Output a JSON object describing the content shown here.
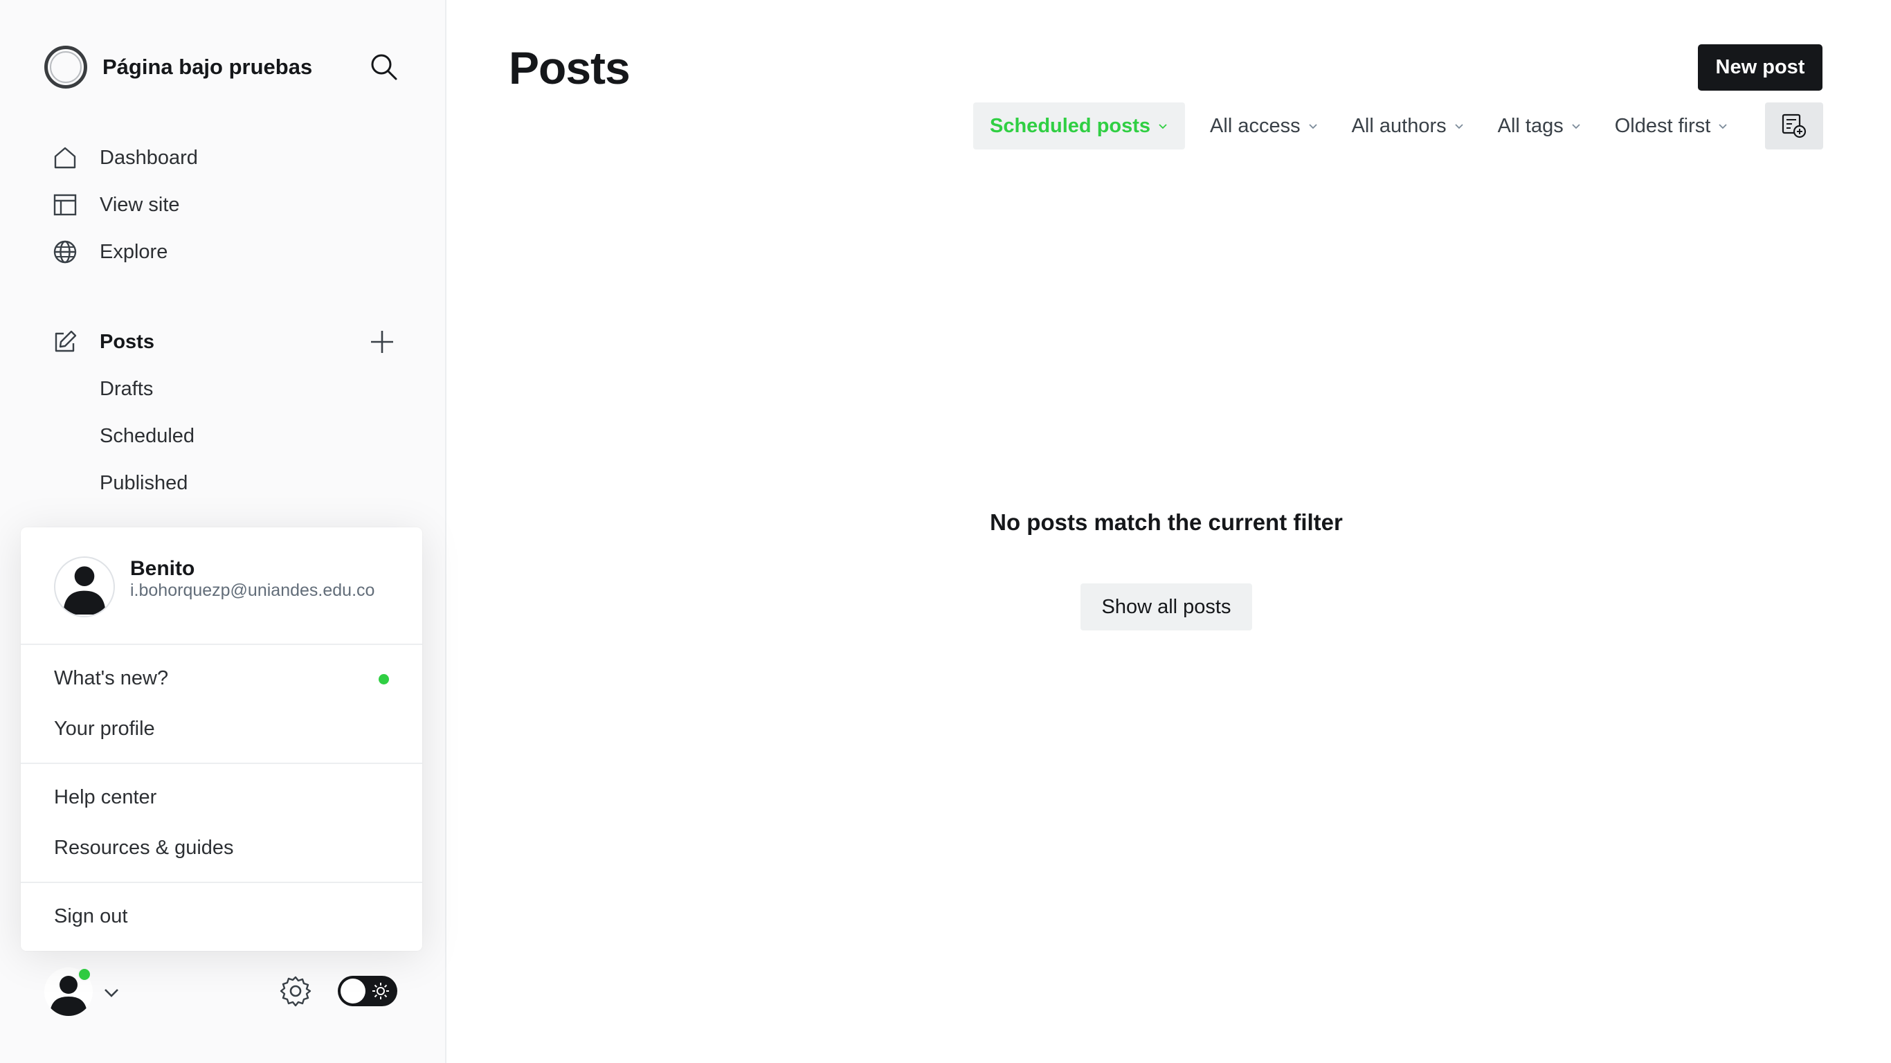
{
  "brand": {
    "name": "Página bajo pruebas"
  },
  "nav": {
    "dashboard": "Dashboard",
    "view_site": "View site",
    "explore": "Explore",
    "posts": "Posts",
    "drafts": "Drafts",
    "scheduled": "Scheduled",
    "published": "Published"
  },
  "user_menu": {
    "name": "Benito",
    "email": "i.bohorquezp@uniandes.edu.co",
    "whats_new": "What's new?",
    "profile": "Your profile",
    "help": "Help center",
    "resources": "Resources & guides",
    "sign_out": "Sign out"
  },
  "main": {
    "title": "Posts",
    "new_post": "New post",
    "filters": {
      "type": "Scheduled posts",
      "access": "All access",
      "authors": "All authors",
      "tags": "All tags",
      "order": "Oldest first"
    },
    "empty_message": "No posts match the current filter",
    "show_all": "Show all posts"
  },
  "colors": {
    "accent_green": "#30cf43",
    "dark": "#15171a",
    "sidebar_bg": "#fafafb"
  },
  "icons": [
    "search-icon",
    "home-icon",
    "layout-icon",
    "globe-icon",
    "pencil-icon",
    "plus-icon",
    "avatar-icon",
    "chevron-down-icon",
    "gear-icon",
    "sun-icon",
    "list-view-icon"
  ]
}
